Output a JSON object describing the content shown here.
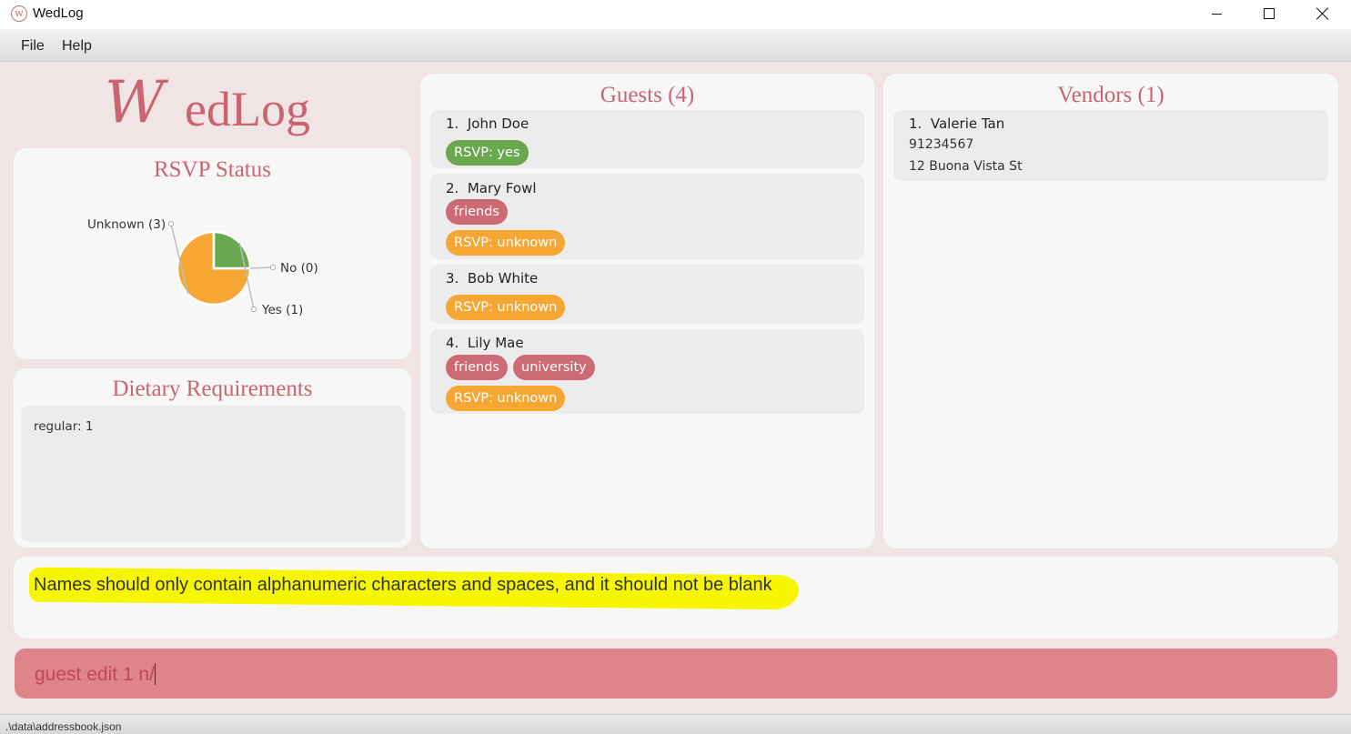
{
  "window": {
    "title": "WedLog"
  },
  "menu": {
    "file": "File",
    "help": "Help"
  },
  "logo": {
    "text": "WedLog",
    "first": "W",
    "rest": "edLog"
  },
  "rsvp": {
    "title": "RSVP Status",
    "labels": {
      "unknown": "Unknown (3)",
      "no": "No (0)",
      "yes": "Yes (1)"
    }
  },
  "chart_data": {
    "type": "pie",
    "title": "RSVP Status",
    "categories": [
      "Unknown",
      "No",
      "Yes"
    ],
    "values": [
      3,
      0,
      1
    ],
    "colors": [
      "#f6a733",
      "#cc6b74",
      "#6aa84f"
    ],
    "legend": "none"
  },
  "dietary": {
    "title": "Dietary Requirements",
    "lines": [
      "regular: 1"
    ]
  },
  "guests": {
    "title": "Guests (4)",
    "items": [
      {
        "index": "1.",
        "name": "John Doe",
        "tags": [],
        "rsvp": "RSVP: yes",
        "rsvp_color": "#6aa84f"
      },
      {
        "index": "2.",
        "name": "Mary Fowl",
        "tags": [
          "friends"
        ],
        "rsvp": "RSVP: unknown",
        "rsvp_color": "#f6a733"
      },
      {
        "index": "3.",
        "name": "Bob White",
        "tags": [],
        "rsvp": "RSVP: unknown",
        "rsvp_color": "#f6a733"
      },
      {
        "index": "4.",
        "name": "Lily Mae",
        "tags": [
          "friends",
          "university"
        ],
        "rsvp": "RSVP: unknown",
        "rsvp_color": "#f6a733"
      }
    ]
  },
  "vendors": {
    "title": "Vendors (1)",
    "items": [
      {
        "index": "1.",
        "name": "Valerie Tan",
        "phone": "91234567",
        "address": "12 Buona Vista St"
      }
    ]
  },
  "result": {
    "message": "Names should only contain alphanumeric characters and spaces, and it should not be blank"
  },
  "command": {
    "value": "guest edit 1 n/"
  },
  "status": {
    "path": ".\\data\\addressbook.json"
  }
}
